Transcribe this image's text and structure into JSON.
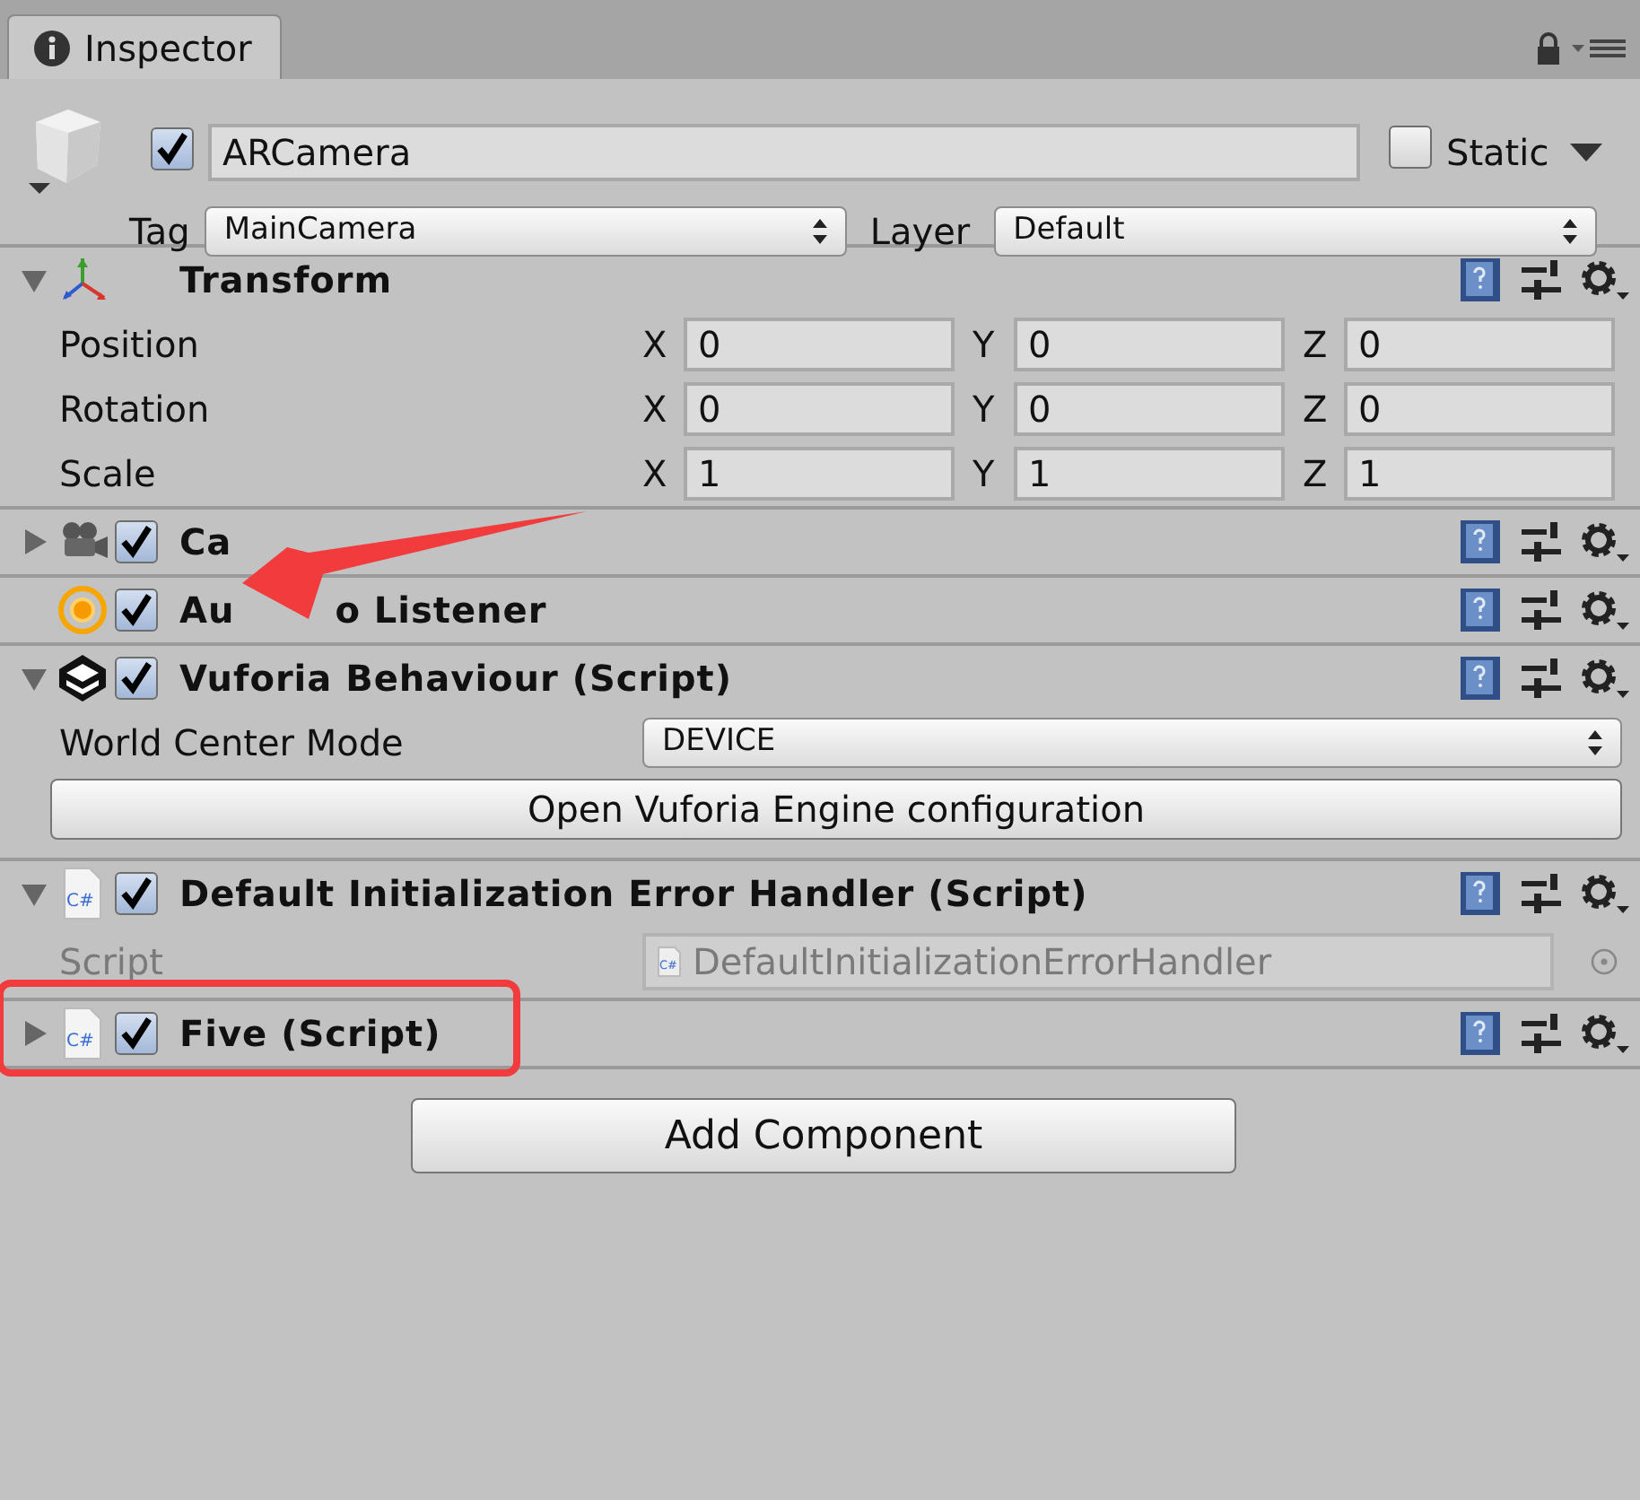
{
  "tab": {
    "label": "Inspector"
  },
  "object": {
    "active": true,
    "name": "ARCamera",
    "static": false,
    "static_label": "Static",
    "tag_label": "Tag",
    "tag": "MainCamera",
    "layer_label": "Layer",
    "layer": "Default"
  },
  "components": [
    {
      "kind": "transform",
      "title": "Transform",
      "expanded": true,
      "rows": [
        {
          "label": "Position",
          "axes": [
            {
              "axis": "X",
              "value": "0"
            },
            {
              "axis": "Y",
              "value": "0"
            },
            {
              "axis": "Z",
              "value": "0"
            }
          ]
        },
        {
          "label": "Rotation",
          "axes": [
            {
              "axis": "X",
              "value": "0"
            },
            {
              "axis": "Y",
              "value": "0"
            },
            {
              "axis": "Z",
              "value": "0"
            }
          ]
        },
        {
          "label": "Scale",
          "axes": [
            {
              "axis": "X",
              "value": "1"
            },
            {
              "axis": "Y",
              "value": "1"
            },
            {
              "axis": "Z",
              "value": "1"
            }
          ]
        }
      ]
    },
    {
      "kind": "camera",
      "title": "Ca",
      "expanded": false,
      "enabled": true
    },
    {
      "kind": "audio",
      "title_parts": [
        "Au",
        "o Listener"
      ],
      "enabled": true,
      "pointed": true
    },
    {
      "kind": "vuforia",
      "title": "Vuforia Behaviour (Script)",
      "expanded": true,
      "enabled": true,
      "fields": [
        {
          "kind": "dropdown",
          "label": "World Center Mode",
          "value": "DEVICE"
        },
        {
          "kind": "button",
          "label": "Open Vuforia Engine configuration"
        }
      ]
    },
    {
      "kind": "script",
      "icon_label": "C#",
      "title": "Default Initialization Error Handler (Script)",
      "expanded": true,
      "enabled": true,
      "fields": [
        {
          "kind": "object",
          "label": "Script",
          "icon_label": "C#",
          "value": "DefaultInitializationErrorHandler",
          "disabled": true
        }
      ]
    },
    {
      "kind": "script",
      "icon_label": "C#",
      "title": "Five (Script)",
      "expanded": false,
      "enabled": true,
      "highlighted": true
    }
  ],
  "add_component": "Add Component"
}
